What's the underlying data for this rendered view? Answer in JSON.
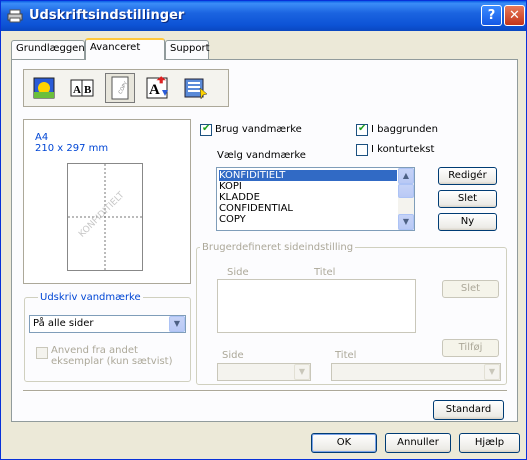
{
  "window": {
    "title": "Udskriftsindstillinger",
    "help_glyph": "?",
    "close_glyph": "✕"
  },
  "tabs": [
    {
      "label": "Grundlæggende"
    },
    {
      "label": "Avanceret"
    },
    {
      "label": "Support"
    }
  ],
  "toolbar": {
    "tools": [
      {
        "icon": "color-quality-icon"
      },
      {
        "icon": "duplex-icon",
        "text": "A|B"
      },
      {
        "icon": "watermark-icon",
        "text": "COPY"
      },
      {
        "icon": "scaling-icon",
        "text": "A"
      },
      {
        "icon": "device-options-icon"
      }
    ]
  },
  "preview": {
    "paper": "A4",
    "size": "210 x 297 mm",
    "watermark_text": "KONFIDITIELT"
  },
  "print_watermark": {
    "group_label": "Udskriv vandmærke",
    "selected": "På alle sider",
    "copy_option_label": "Anvend fra andet eksemplar (kun sætvist)"
  },
  "watermark": {
    "use_label": "Brug vandmærke",
    "background_label": "I baggrunden",
    "outline_label": "I konturtekst",
    "choose_label": "Vælg vandmærke",
    "items": [
      "KONFIDITIELT",
      "KOPI",
      "KLADDE",
      "CONFIDENTIAL",
      "COPY"
    ],
    "selected_index": 0,
    "edit_label": "Redigér",
    "delete_label": "Slet",
    "new_label": "Ny"
  },
  "custom_page": {
    "group_label": "Brugerdefineret sideindstilling",
    "col_side": "Side",
    "col_title": "Titel",
    "delete_label": "Slet",
    "side_label": "Side",
    "title_label": "Titel",
    "add_label": "Tilføj"
  },
  "footer": {
    "standard_label": "Standard",
    "ok_label": "OK",
    "cancel_label": "Annuller",
    "help_label": "Hjælp"
  }
}
